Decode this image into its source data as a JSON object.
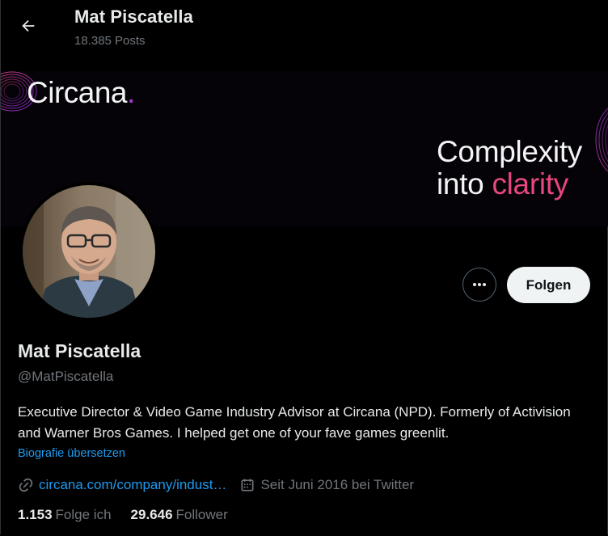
{
  "header": {
    "title": "Mat Piscatella",
    "posts_count": "18.385 Posts",
    "back_icon": "arrow-left-icon"
  },
  "banner": {
    "logo_text": "Circana",
    "logo_dot": ".",
    "tagline_line1": "Complexity",
    "tagline_line2_prefix": "into ",
    "tagline_line2_accent": "clarity",
    "accent_color": "#e8467e",
    "brand_purple": "#b03dd9"
  },
  "actions": {
    "more_icon": "more-dots-icon",
    "follow_label": "Folgen"
  },
  "profile": {
    "name": "Mat Piscatella",
    "handle": "@MatPiscatella",
    "bio": "Executive Director & Video Game Industry Advisor at Circana (NPD). Formerly of Activision and Warner Bros Games. I helped get one of your fave games greenlit.",
    "translate_label": "Biografie übersetzen",
    "website": "circana.com/company/indust…",
    "joined": "Seit Juni 2016 bei Twitter",
    "link_icon": "link-icon",
    "calendar_icon": "calendar-icon"
  },
  "stats": {
    "following_count": "1.153",
    "following_label": "Folge ich",
    "followers_count": "29.646",
    "followers_label": "Follower"
  },
  "colors": {
    "background": "#000000",
    "link": "#1d9bf0",
    "secondary_text": "#71767b",
    "primary_text": "#e7e9ea"
  }
}
